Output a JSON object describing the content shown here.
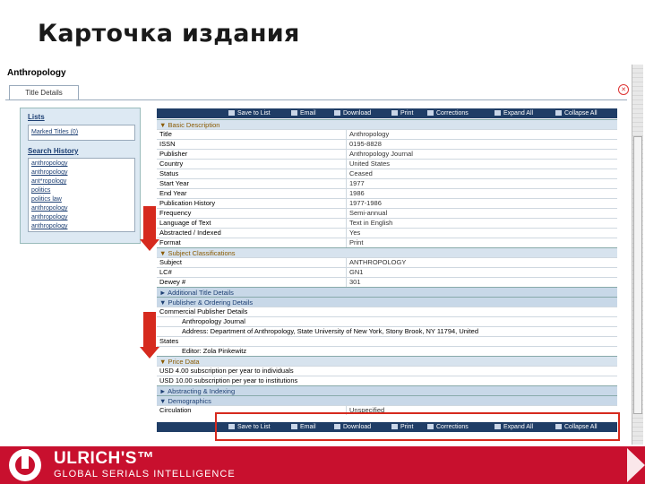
{
  "slide_title": "Карточка издания",
  "record": {
    "title": "Anthropology",
    "tab_label": "Title Details"
  },
  "left_panel": {
    "lists_title": "Lists",
    "lists_items": [
      "Marked Titles (0)"
    ],
    "history_title": "Search History",
    "history_items": [
      "anthropology",
      "anthropology",
      "ant*ropology",
      "politics",
      "politics law",
      "anthropology",
      "anthropology",
      "anthropology"
    ]
  },
  "toolbar": {
    "save_label": "Save to List",
    "email_label": "Email",
    "download_label": "Download",
    "print_label": "Print",
    "corrections_label": "Corrections",
    "expand_label": "Expand All",
    "collapse_label": "Collapse All"
  },
  "sections": {
    "basic": "▼ Basic Description",
    "subject": "▼ Subject Classifications",
    "additional": "► Additional Title Details",
    "publisher": "▼ Publisher & Ordering Details",
    "price": "▼ Price Data",
    "abstracting": "► Abstracting & Indexing",
    "demographics": "▼ Demographics"
  },
  "basic_rows": [
    {
      "label": "Title",
      "value": "Anthropology"
    },
    {
      "label": "ISSN",
      "value": "0195-8828"
    },
    {
      "label": "Publisher",
      "value": "Anthropology Journal"
    },
    {
      "label": "Country",
      "value": "United States"
    },
    {
      "label": "Status",
      "value": "Ceased"
    },
    {
      "label": "Start Year",
      "value": "1977"
    },
    {
      "label": "End Year",
      "value": "1986"
    },
    {
      "label": "Publication History",
      "value": "1977-1986"
    },
    {
      "label": "Frequency",
      "value": "Semi-annual"
    },
    {
      "label": "Language of Text",
      "value": "Text in English"
    },
    {
      "label": "Abstracted / Indexed",
      "value": "Yes"
    },
    {
      "label": "Format",
      "value": "Print"
    }
  ],
  "subject_rows": [
    {
      "label": "Subject",
      "value": "ANTHROPOLOGY"
    },
    {
      "label": "LC#",
      "value": "GN1"
    },
    {
      "label": "Dewey #",
      "value": "301"
    }
  ],
  "publisher_lines": [
    "Commercial Publisher Details",
    "Anthropology Journal",
    "Address: Department of Anthropology, State University of New York, Stony Brook, NY 11794, United",
    "States",
    "Editor: Zola Pinkewitz"
  ],
  "price_lines": [
    "USD 4.00 subscription per year to individuals",
    "USD 10.00 subscription per year to institutions"
  ],
  "demographics_rows": [
    {
      "label": "Circulation",
      "value": "Unspecified"
    }
  ],
  "footer": {
    "brand": "ULRICH'S™",
    "tagline": "GLOBAL SERIALS INTELLIGENCE"
  },
  "colors": {
    "brand_red": "#c8102e",
    "toolbar_navy": "#1f3d66",
    "arrow_red": "#d62a1e"
  }
}
